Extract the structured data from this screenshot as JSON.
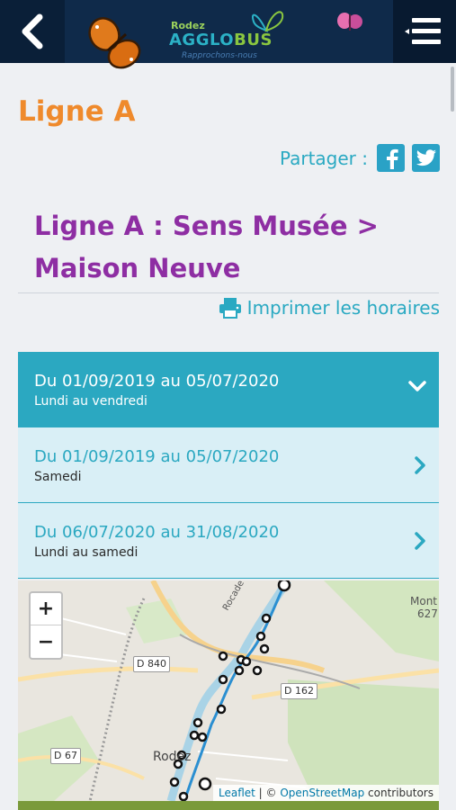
{
  "header": {
    "logo_prefix": "Rodez",
    "logo_part1": "AGGLO",
    "logo_part2": "BUS",
    "logo_tagline": "Rapprochons-nous",
    "icons": {
      "back": "chevron-left-icon",
      "menu": "hamburger-menu-icon"
    }
  },
  "page": {
    "title": "Ligne A",
    "share_label": "Partager :",
    "route_title": "Ligne A : Sens Musée > Maison Neuve",
    "print_label": "Imprimer les horaires"
  },
  "periods": [
    {
      "dates": "Du 01/09/2019 au 05/07/2020",
      "days": "Lundi au vendredi",
      "expanded": true
    },
    {
      "dates": "Du 01/09/2019 au 05/07/2020",
      "days": "Samedi",
      "expanded": false
    },
    {
      "dates": "Du 06/07/2020 au 31/08/2020",
      "days": "Lundi au samedi",
      "expanded": false
    }
  ],
  "map": {
    "zoom_in": "+",
    "zoom_out": "−",
    "labels": {
      "d840": "D 840",
      "d162": "D 162",
      "d67": "D 67",
      "city": "Rodez",
      "rocade": "Rocade de Rodez",
      "mont": "Mont",
      "alt": "627"
    },
    "attribution": {
      "leaflet": "Leaflet",
      "sep": " | © ",
      "osm": "OpenStreetMap",
      "contributors": " contributors"
    }
  },
  "colors": {
    "header": "#0f2a4a",
    "accent": "#2ba8c1",
    "title_orange": "#ef8a2c",
    "route_purple": "#8e2ea3"
  }
}
